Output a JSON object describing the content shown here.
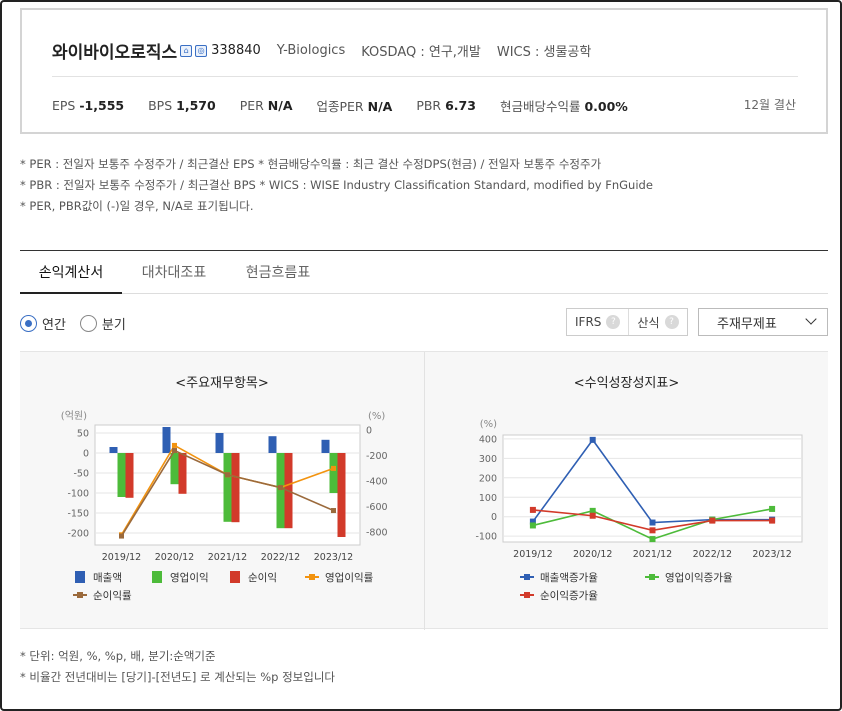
{
  "company": {
    "name": "와이바이오로직스",
    "icons": [
      "home-icon",
      "chart-icon"
    ],
    "code": "338840",
    "eng_name": "Y-Biologics",
    "market": "KOSDAQ : 연구,개발",
    "wics": "WICS : 생물공학"
  },
  "metrics": [
    {
      "label": "EPS",
      "value": "-1,555"
    },
    {
      "label": "BPS",
      "value": "1,570"
    },
    {
      "label": "PER",
      "value": "N/A"
    },
    {
      "label": "업종PER",
      "value": "N/A"
    },
    {
      "label": "PBR",
      "value": "6.73"
    },
    {
      "label": "현금배당수익률",
      "value": "0.00%"
    }
  ],
  "settlement": "12월 결산",
  "notes": [
    "* PER : 전일자 보통주 수정주가 / 최근결산 EPS * 현금배당수익률 : 최근 결산 수정DPS(현금) / 전일자 보통주 수정주가",
    "* PBR : 전일자 보통주 수정주가 / 최근결산 BPS * WICS : WISE Industry Classification Standard, modified by FnGuide",
    "* PER, PBR값이 (-)일 경우, N/A로 표기됩니다."
  ],
  "tabs": [
    "손익계산서",
    "대차대조표",
    "현금흐름표"
  ],
  "period": {
    "annual": "연간",
    "quarterly": "분기"
  },
  "standards": {
    "ifrs": "IFRS",
    "calc": "산식",
    "qmark": "?"
  },
  "select": {
    "value": "주재무제표"
  },
  "colors": {
    "blue": "#2f5fb3",
    "green": "#4dbb3a",
    "red": "#d23a2a",
    "orange": "#f2930f",
    "brown": "#9b6a3c"
  },
  "chart_data": [
    {
      "type": "bar",
      "title": "<주요재무항목>",
      "left_unit": "(억원)",
      "right_unit": "(%)",
      "categories": [
        "2019/12",
        "2020/12",
        "2021/12",
        "2022/12",
        "2023/12"
      ],
      "ylim": [
        -230,
        70
      ],
      "yticks": [
        50,
        0,
        -50,
        -100,
        -150,
        -200
      ],
      "y2lim": [
        -900,
        40
      ],
      "y2ticks": [
        0,
        -200,
        -400,
        -600,
        -800
      ],
      "series": [
        {
          "name": "매출액",
          "kind": "bar",
          "axis": "left",
          "color": "#2f5fb3",
          "values": [
            15,
            65,
            50,
            42,
            33
          ]
        },
        {
          "name": "영업이익",
          "kind": "bar",
          "axis": "left",
          "color": "#4dbb3a",
          "values": [
            -110,
            -78,
            -172,
            -188,
            -100
          ]
        },
        {
          "name": "순이익",
          "kind": "bar",
          "axis": "left",
          "color": "#d23a2a",
          "values": [
            -112,
            -102,
            -173,
            -188,
            -210
          ]
        },
        {
          "name": "영업이익률",
          "kind": "line",
          "axis": "right",
          "color": "#f2930f",
          "values": [
            -820,
            -120,
            -350,
            -450,
            -300
          ]
        },
        {
          "name": "순이익률",
          "kind": "line",
          "axis": "right",
          "color": "#9b6a3c",
          "values": [
            -830,
            -160,
            -350,
            -450,
            -630
          ]
        }
      ]
    },
    {
      "type": "line",
      "title": "<수익성장성지표>",
      "left_unit": "(%)",
      "categories": [
        "2019/12",
        "2020/12",
        "2021/12",
        "2022/12",
        "2023/12"
      ],
      "ylim": [
        -130,
        420
      ],
      "yticks": [
        400,
        300,
        200,
        100,
        0,
        -100
      ],
      "series": [
        {
          "name": "매출액증가율",
          "color": "#2f5fb3",
          "values": [
            -25,
            395,
            -30,
            -15,
            -15
          ]
        },
        {
          "name": "영업이익증가율",
          "color": "#4dbb3a",
          "values": [
            -45,
            30,
            -115,
            -15,
            40
          ]
        },
        {
          "name": "순이익증가율",
          "color": "#d23a2a",
          "values": [
            35,
            5,
            -70,
            -20,
            -20
          ]
        }
      ]
    }
  ],
  "footnotes": [
    "* 단위: 억원, %, %p, 배, 분기:순액기준",
    "* 비율간 전년대비는 [당기]-[전년도] 로 계산되는 %p 정보입니다"
  ]
}
